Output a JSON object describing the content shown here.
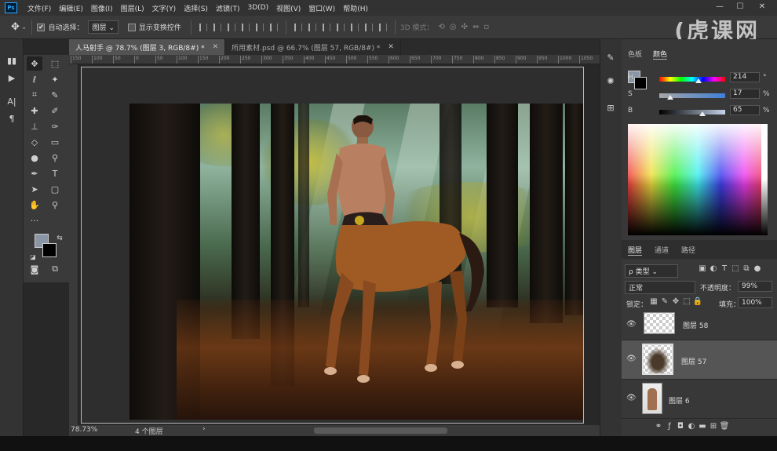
{
  "menu": {
    "items": [
      "文件(F)",
      "编辑(E)",
      "图像(I)",
      "图层(L)",
      "文字(Y)",
      "选择(S)",
      "滤镜(T)",
      "3D(D)",
      "视图(V)",
      "窗口(W)",
      "帮助(H)"
    ],
    "logo": "Ps"
  },
  "window_controls": [
    "—",
    "☐",
    "✕"
  ],
  "options": {
    "auto_select_label": "自动选择：",
    "auto_select_value": "图层",
    "show_transform_label": "显示变换控件",
    "mode_3d_label": "3D 模式："
  },
  "watermark": "(虎课网",
  "tabs": [
    {
      "label": "人马射手 @ 78.7% (图层 3, RGB/8#) *",
      "active": true
    },
    {
      "label": "所用素材.psd @ 66.7% (图层 57, RGB/8#) *",
      "active": false
    }
  ],
  "tab_close": "✕",
  "ruler_marks": [
    "150",
    "100",
    "50",
    "0",
    "50",
    "100",
    "150",
    "200",
    "250",
    "300",
    "350",
    "400",
    "450",
    "500",
    "550",
    "600",
    "650",
    "700",
    "750",
    "800",
    "850",
    "900",
    "950",
    "1000",
    "1050",
    "1100"
  ],
  "status": {
    "zoom": "78.73%",
    "doc_info": "4 个图层",
    "arrow": "›"
  },
  "color_panel": {
    "tabs": [
      "色板",
      "颜色"
    ],
    "active_tab": "颜色",
    "h_label": "H",
    "h_value": "214",
    "h_unit": "°",
    "s_label": "S",
    "s_value": "17",
    "s_unit": "%",
    "b_label": "B",
    "b_value": "65",
    "b_unit": "%",
    "h_level": 0.594,
    "s_level": 0.17,
    "b_level": 0.65,
    "foreground_color": "#8a96a6",
    "background_color": "#000000"
  },
  "layers_panel": {
    "tabs": [
      "图层",
      "通道",
      "路径"
    ],
    "active_tab": "图层",
    "filter_kind": "ρ 类型",
    "blend_mode": "正常",
    "opacity_label": "不透明度：",
    "opacity_value": "99%",
    "lock_label": "锁定：",
    "fill_label": "填充：",
    "fill_value": "100%",
    "layers": [
      {
        "name": "图层 58",
        "visible": true,
        "selected": false
      },
      {
        "name": "图层 57",
        "visible": true,
        "selected": true
      },
      {
        "name": "图层 6",
        "visible": true,
        "selected": false
      }
    ],
    "footer_icons": [
      "link-icon",
      "fx-icon",
      "mask-icon",
      "adjustment-icon",
      "group-icon",
      "new-layer-icon",
      "trash-icon"
    ]
  },
  "toolbar_tools": [
    "move-tool",
    "marquee-tool",
    "lasso-tool",
    "magic-wand-tool",
    "crop-tool",
    "eyedropper-tool",
    "healing-brush-tool",
    "brush-tool",
    "clone-stamp-tool",
    "history-brush-tool",
    "eraser-tool",
    "gradient-tool",
    "blur-tool",
    "dodge-tool",
    "pen-tool",
    "type-tool",
    "path-selection-tool",
    "shape-tool",
    "hand-tool",
    "zoom-tool",
    "more-tools"
  ]
}
